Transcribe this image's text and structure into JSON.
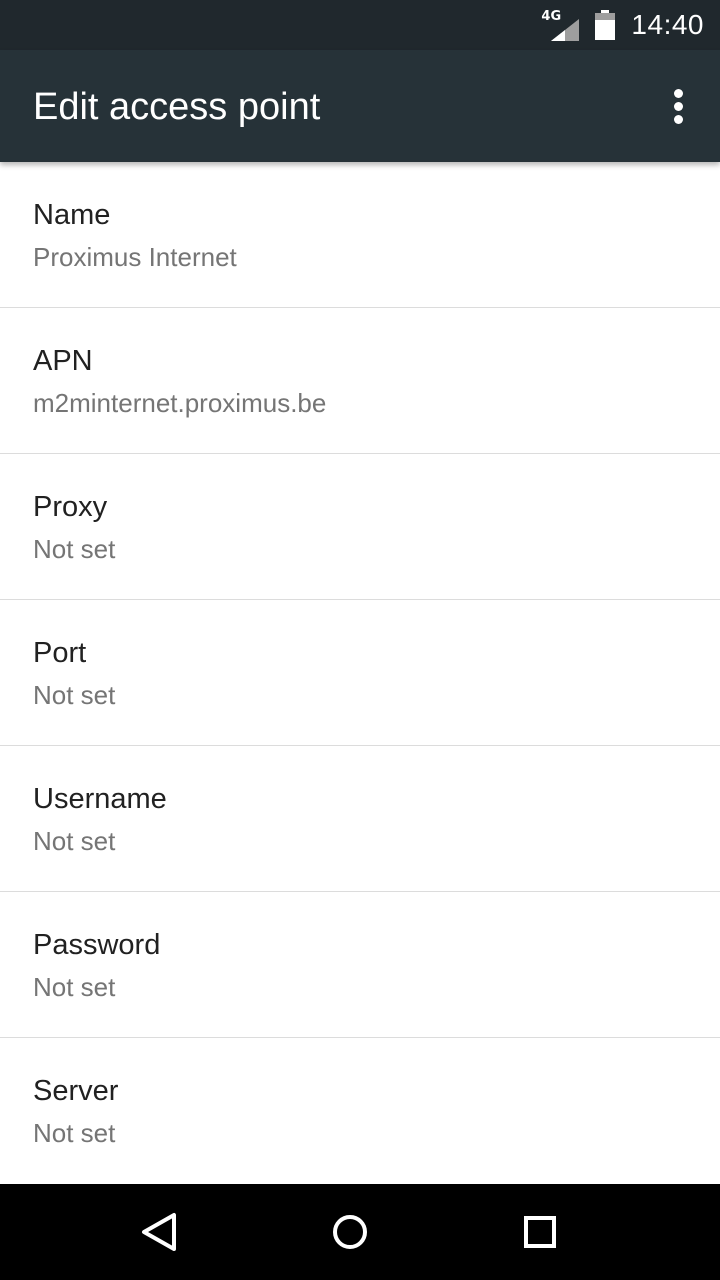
{
  "status_bar": {
    "network_type": "4G",
    "time": "14:40",
    "icons": [
      "signal-icon",
      "battery-icon"
    ]
  },
  "app_bar": {
    "title": "Edit access point",
    "overflow_icon": "more-vert-icon"
  },
  "settings": [
    {
      "title": "Name",
      "value": "Proximus Internet"
    },
    {
      "title": "APN",
      "value": "m2minternet.proximus.be"
    },
    {
      "title": "Proxy",
      "value": "Not set"
    },
    {
      "title": "Port",
      "value": "Not set"
    },
    {
      "title": "Username",
      "value": "Not set"
    },
    {
      "title": "Password",
      "value": "Not set"
    },
    {
      "title": "Server",
      "value": "Not set"
    }
  ],
  "nav_bar": {
    "icons": [
      "back-icon",
      "home-icon",
      "recents-icon"
    ]
  },
  "colors": {
    "status_bar": "#20282d",
    "app_bar": "#263238",
    "title_text": "#212121",
    "value_text": "#757575",
    "divider": "#dcdcdc"
  }
}
